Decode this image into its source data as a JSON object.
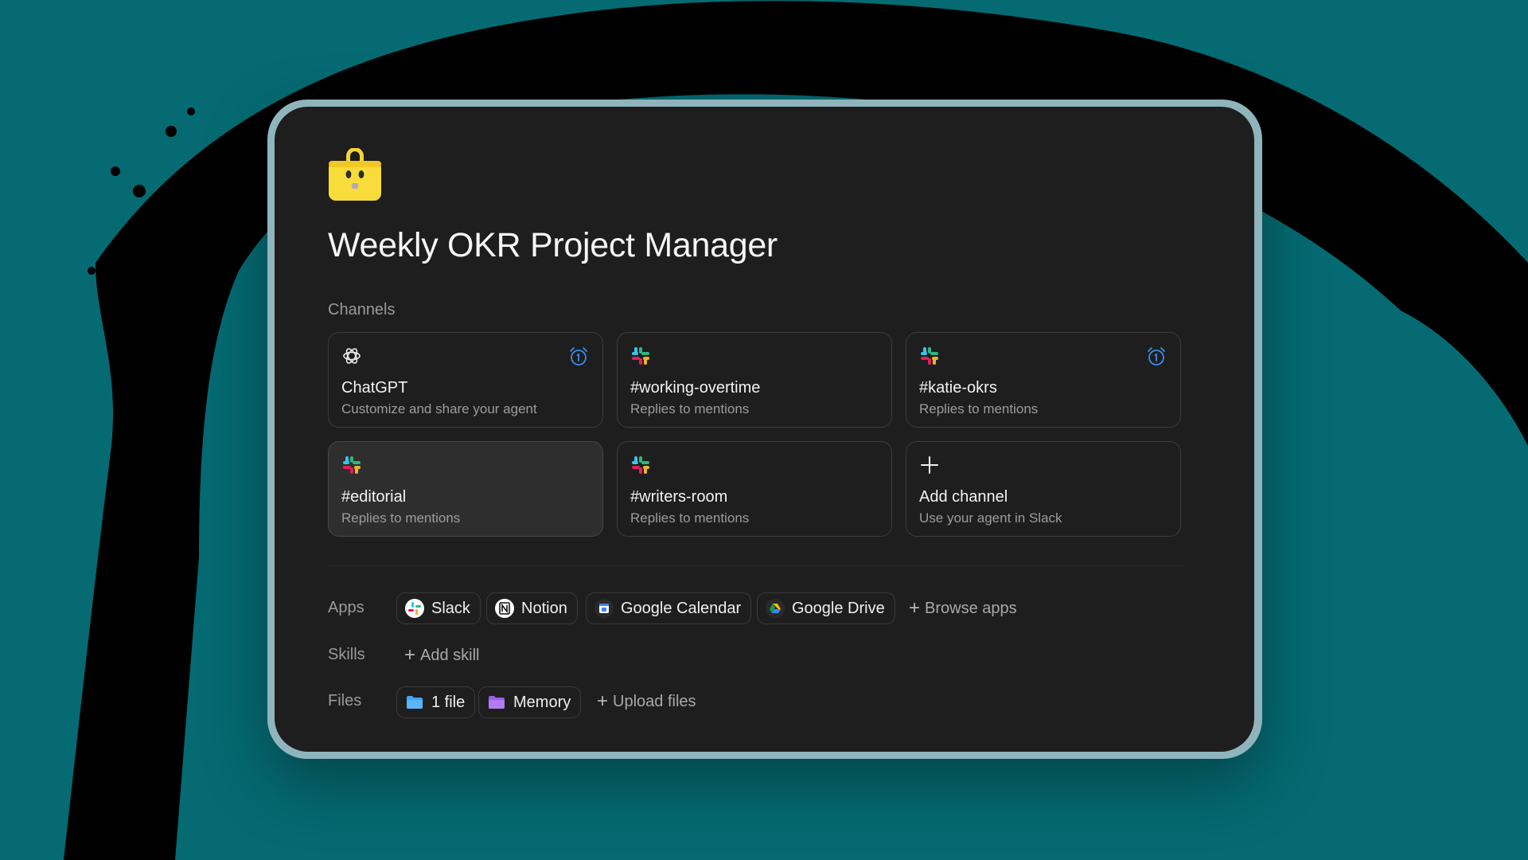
{
  "agent": {
    "title": "Weekly OKR Project Manager",
    "logo_icon": "toolbox-mascot-icon"
  },
  "channels": {
    "label": "Channels",
    "items": [
      {
        "title": "ChatGPT",
        "subtitle": "Customize and share your agent",
        "icon": "openai-icon",
        "scheduled": true
      },
      {
        "title": "#working-overtime",
        "subtitle": "Replies to mentions",
        "icon": "slack-icon",
        "scheduled": false
      },
      {
        "title": "#katie-okrs",
        "subtitle": "Replies to mentions",
        "icon": "slack-icon",
        "scheduled": true
      },
      {
        "title": "#editorial",
        "subtitle": "Replies to mentions",
        "icon": "slack-icon",
        "scheduled": false,
        "selected": true
      },
      {
        "title": "#writers-room",
        "subtitle": "Replies to mentions",
        "icon": "slack-icon",
        "scheduled": false
      },
      {
        "title": "Add channel",
        "subtitle": "Use your agent in Slack",
        "icon": "plus-icon",
        "scheduled": false
      }
    ]
  },
  "apps": {
    "label": "Apps",
    "items": [
      {
        "name": "Slack",
        "icon": "slack-icon"
      },
      {
        "name": "Notion",
        "icon": "notion-icon"
      },
      {
        "name": "Google Calendar",
        "icon": "google-calendar-icon"
      },
      {
        "name": "Google Drive",
        "icon": "google-drive-icon"
      }
    ],
    "browse_label": "Browse apps"
  },
  "skills": {
    "label": "Skills",
    "add_label": "Add skill"
  },
  "files": {
    "label": "Files",
    "items": [
      {
        "name": "1 file",
        "icon": "blue-folder-icon"
      },
      {
        "name": "Memory",
        "icon": "purple-folder-icon"
      }
    ],
    "upload_label": "Upload files"
  },
  "colors": {
    "background": "#056a72",
    "panel": "#1e1e1e",
    "accent_blue": "#3b8eea"
  }
}
